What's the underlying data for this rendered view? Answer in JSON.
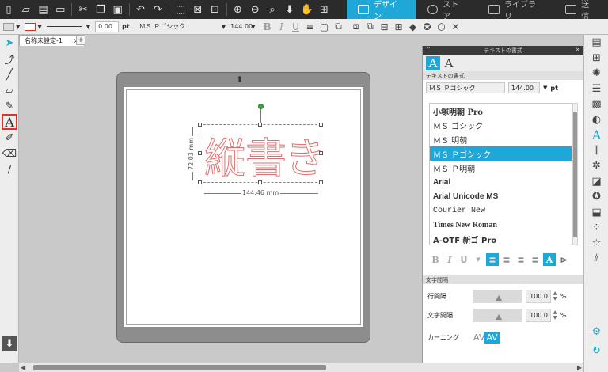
{
  "toolbar": {
    "icons": [
      "new-file-icon",
      "open-icon",
      "save-icon",
      "print-icon",
      "cut-icon",
      "copy-icon",
      "paste-icon",
      "undo-icon",
      "redo-icon",
      "select-all-icon",
      "deselect-icon",
      "select-trace-icon",
      "zoom-in-icon",
      "zoom-out-icon",
      "zoom-fit-icon",
      "move-down-icon",
      "pan-icon",
      "add-page-icon"
    ]
  },
  "nav": [
    {
      "label": "デザイン",
      "active": true
    },
    {
      "label": "ストア",
      "active": false
    },
    {
      "label": "ライブラリ",
      "active": false
    },
    {
      "label": "送信",
      "active": false
    }
  ],
  "props": {
    "line_width": "0.00",
    "line_unit": "pt",
    "font_name": "ＭＳ Ｐゴシック",
    "font_size": "144.00"
  },
  "document": {
    "tab_label": "名称未設定-1",
    "close": "×",
    "add": "+",
    "text_chars": [
      "縦",
      "書",
      "き"
    ],
    "width_dim": "144.46 mm",
    "height_dim": "72.03 mm"
  },
  "panel": {
    "title": "テキストの書式",
    "section_title": "テキストの書式",
    "font_name": "ＭＳ Ｐゴシック",
    "font_size": "144.00",
    "size_unit": "pt",
    "fonts": [
      {
        "name": "小塚明朝 Pro",
        "selected": false
      },
      {
        "name": "ＭＳ ゴシック",
        "selected": false
      },
      {
        "name": "ＭＳ 明朝",
        "selected": false
      },
      {
        "name": "ＭＳ Ｐゴシック",
        "selected": true
      },
      {
        "name": "ＭＳ Ｐ明朝",
        "selected": false
      },
      {
        "name": "Arial",
        "selected": false
      },
      {
        "name": "Arial Unicode MS",
        "selected": false
      },
      {
        "name": "Courier New",
        "selected": false
      },
      {
        "name": "Times New Roman",
        "selected": false
      },
      {
        "name": "A-OTF 新ゴ Pro",
        "selected": false
      }
    ],
    "spacing_title": "文字間隔",
    "line_spacing_label": "行間隔",
    "line_spacing_value": "100.0",
    "char_spacing_label": "文字間隔",
    "char_spacing_value": "100.0",
    "percent": "%",
    "kerning_label": "カーニング"
  }
}
